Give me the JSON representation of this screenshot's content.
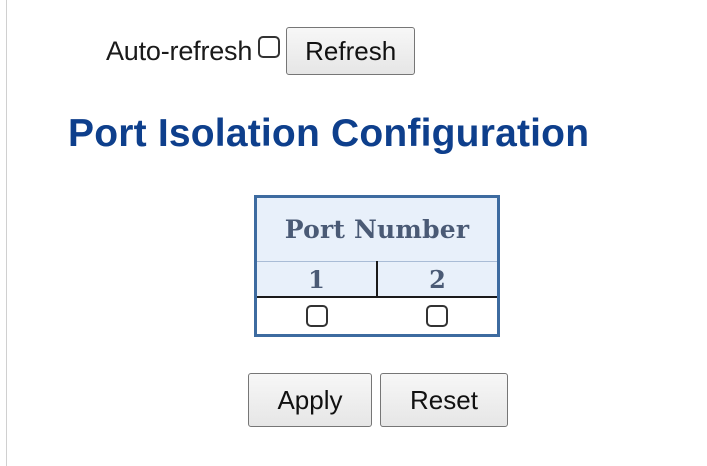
{
  "toolbar": {
    "auto_refresh_label": "Auto-refresh",
    "auto_refresh_checked": false,
    "refresh_label": "Refresh"
  },
  "page": {
    "title": "Port Isolation Configuration"
  },
  "port_table": {
    "header": "Port Number",
    "ports": [
      {
        "number": "1",
        "checked": false
      },
      {
        "number": "2",
        "checked": false
      }
    ]
  },
  "actions": {
    "apply_label": "Apply",
    "reset_label": "Reset"
  }
}
